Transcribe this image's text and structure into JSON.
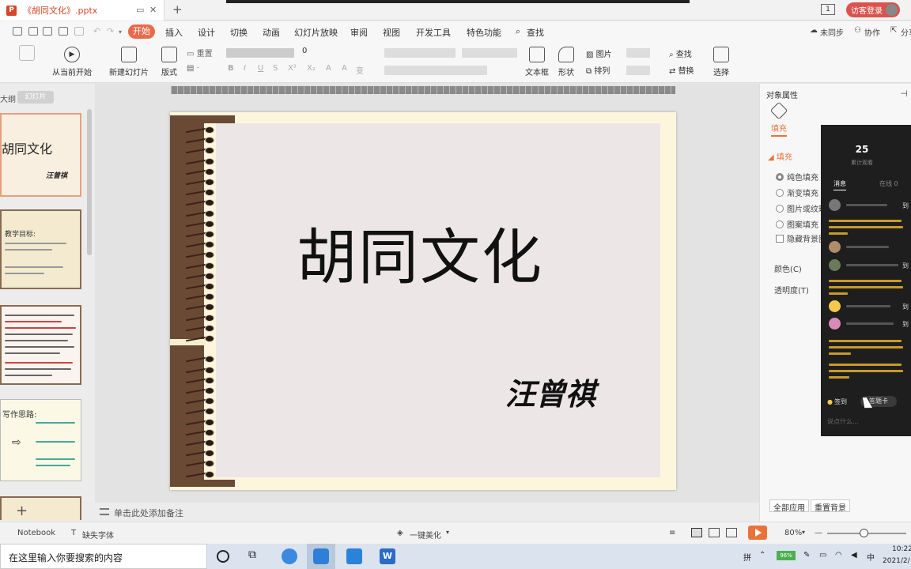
{
  "titlebar": {
    "file_tab": "《胡同文化》.pptx",
    "window_badge": "1",
    "login_label": "访客登录"
  },
  "menubar": {
    "active_tab": "开始",
    "tabs": [
      "插入",
      "设计",
      "切换",
      "动画",
      "幻灯片放映",
      "审阅",
      "视图",
      "开发工具",
      "特色功能"
    ],
    "search": "查找",
    "sync": "未同步",
    "collab": "协作",
    "share": "分享"
  },
  "ribbon": {
    "play_from_current": "从当前开始",
    "new_slide": "新建幻灯片",
    "layout": "版式",
    "reset": "重置",
    "font_size": "0",
    "textbox": "文本框",
    "shape": "形状",
    "arrange": "排列",
    "picture": "图片",
    "find": "查找",
    "replace": "替换",
    "select": "选择"
  },
  "leftpanel": {
    "tab_outline": "大纲",
    "tab_slides": "幻灯片",
    "thumb1_title": "胡同文化",
    "thumb1_author": "汪曾祺",
    "thumb2_heading": "教学目标:",
    "thumb4_heading": "写作思路:"
  },
  "slide": {
    "title": "胡同文化",
    "author": "汪曾祺"
  },
  "notes": {
    "placeholder": "单击此处添加备注"
  },
  "properties": {
    "panel_title": "对象属性",
    "tab_fill": "填充",
    "section_fill": "填充",
    "options": [
      "纯色填充",
      "渐变填充",
      "图片或纹理填充",
      "图案填充",
      "隐藏背景图形"
    ],
    "color_label": "颜色(C)",
    "transparency_label": "透明度(T)",
    "apply_all": "全部应用",
    "reset_bg": "重置背景"
  },
  "chat": {
    "viewer_count": "25",
    "viewer_label": "累计观看",
    "tab_messages": "消息",
    "tab_online": "在线 0",
    "sign_in": "签到",
    "answer_card": "答题卡",
    "input_placeholder": "说点什么..."
  },
  "statusbar": {
    "notebook": "Notebook",
    "missing_font": "缺失字体",
    "beautify": "一键美化",
    "zoom": "80%"
  },
  "taskbar": {
    "search_placeholder": "在这里输入你要搜索的内容",
    "ime": "拼",
    "battery": "96%",
    "time": "10:22",
    "date": "2021/2/"
  },
  "colors": {
    "accent": "#e96a4a",
    "spine_brown": "#6b4a35",
    "slide_bg": "#fdf6dc"
  }
}
